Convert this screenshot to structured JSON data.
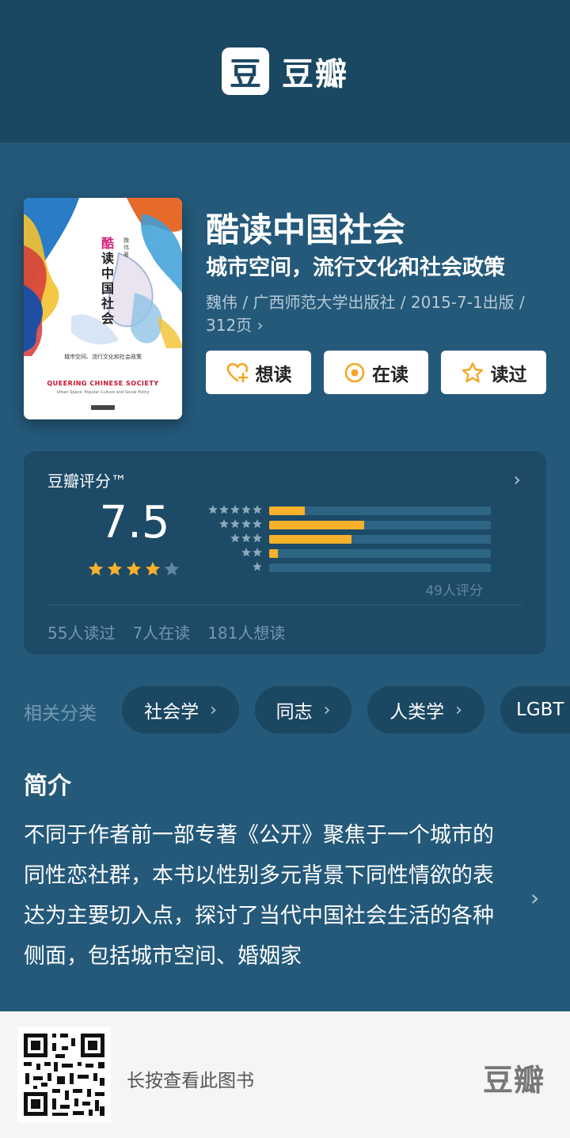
{
  "header": {
    "logo_mark": "豆",
    "logo_text": "豆瓣"
  },
  "book": {
    "title": "酷读中国社会",
    "subtitle": "城市空间，流行文化和社会政策",
    "meta": "魏伟 / 广西师范大学出版社 / 2015-7-1出版 / 312页 ›",
    "cover": {
      "title_first": "酷",
      "title_rest": "读中国社会",
      "author": "魏伟 著",
      "subtitle": "城市空间、流行文化和社会政策",
      "en_title": "QUEERING CHINESE SOCIETY",
      "en_subtitle": "Urban Space, Popular Culture and Social Policy"
    }
  },
  "actions": {
    "want": "想读",
    "reading": "在读",
    "read": "读过"
  },
  "rating": {
    "label": "豆瓣评分™",
    "arrow": "›",
    "score": "7.5",
    "stars": 4,
    "distribution": [
      {
        "stars": 5,
        "fraction": 0.16
      },
      {
        "stars": 4,
        "fraction": 0.43
      },
      {
        "stars": 3,
        "fraction": 0.37
      },
      {
        "stars": 2,
        "fraction": 0.04
      },
      {
        "stars": 1,
        "fraction": 0.0
      }
    ],
    "count": "49人评分",
    "read": "55人读过",
    "reading": "7人在读",
    "want": "181人想读"
  },
  "categories": {
    "label": "相关分类",
    "items": [
      "社会学",
      "同志",
      "人类学",
      "LGBT"
    ]
  },
  "intro": {
    "heading": "简介",
    "text": "不同于作者前一部专著《公开》聚焦于一个城市的同性恋社群，本书以性别多元背景下同性情欲的表达为主要切入点，探讨了当代中国社会生活的各种侧面，包括城市空间、婚姻家",
    "arrow": "›"
  },
  "footer": {
    "text": "长按查看此图书",
    "logo": "豆瓣"
  },
  "colors": {
    "background": "#24597a",
    "header": "#1a4761",
    "accent": "#f7b12b",
    "button_icon": "#f5a623"
  }
}
